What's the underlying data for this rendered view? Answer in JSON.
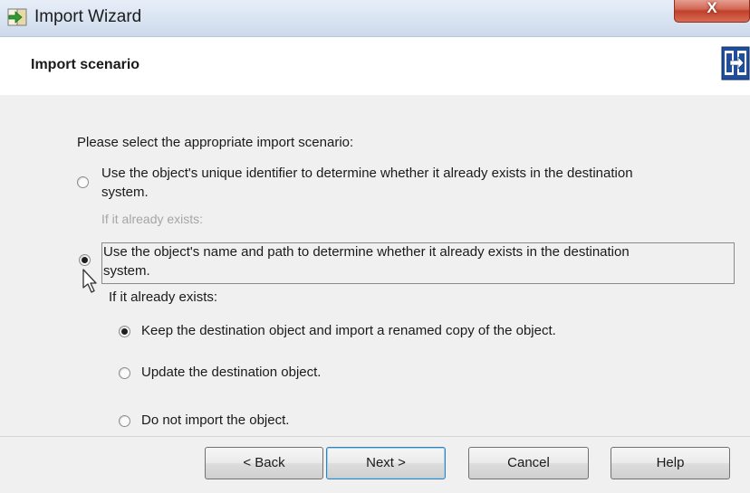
{
  "window": {
    "title": "Import Wizard",
    "close_glyph": "X"
  },
  "header": {
    "title": "Import scenario",
    "logo_icon": "wizard-logo-icon"
  },
  "content": {
    "prompt": "Please select the appropriate import scenario:",
    "scenario_unique_id": {
      "line1": "Use the object's unique identifier to determine whether it already exists in the destination",
      "line2": "system.",
      "sublabel": "If it already exists:",
      "selected": false
    },
    "scenario_name_path": {
      "line1": "Use the object's name and path to determine whether it already exists in the destination",
      "line2": "system.",
      "sublabel": "If it already exists:",
      "selected": true
    },
    "options": [
      {
        "label": "Keep the destination object and import a renamed copy of the object.",
        "selected": true
      },
      {
        "label": "Update the destination object.",
        "selected": false
      },
      {
        "label": "Do not import the object.",
        "selected": false
      }
    ]
  },
  "buttons": {
    "back": "< Back",
    "next": "Next >",
    "cancel": "Cancel",
    "help": "Help"
  },
  "colors": {
    "titlebar": "#d9e4f2",
    "body": "#f0f0f0",
    "close": "#c7412c",
    "default_button_border": "#3c7fb1"
  }
}
